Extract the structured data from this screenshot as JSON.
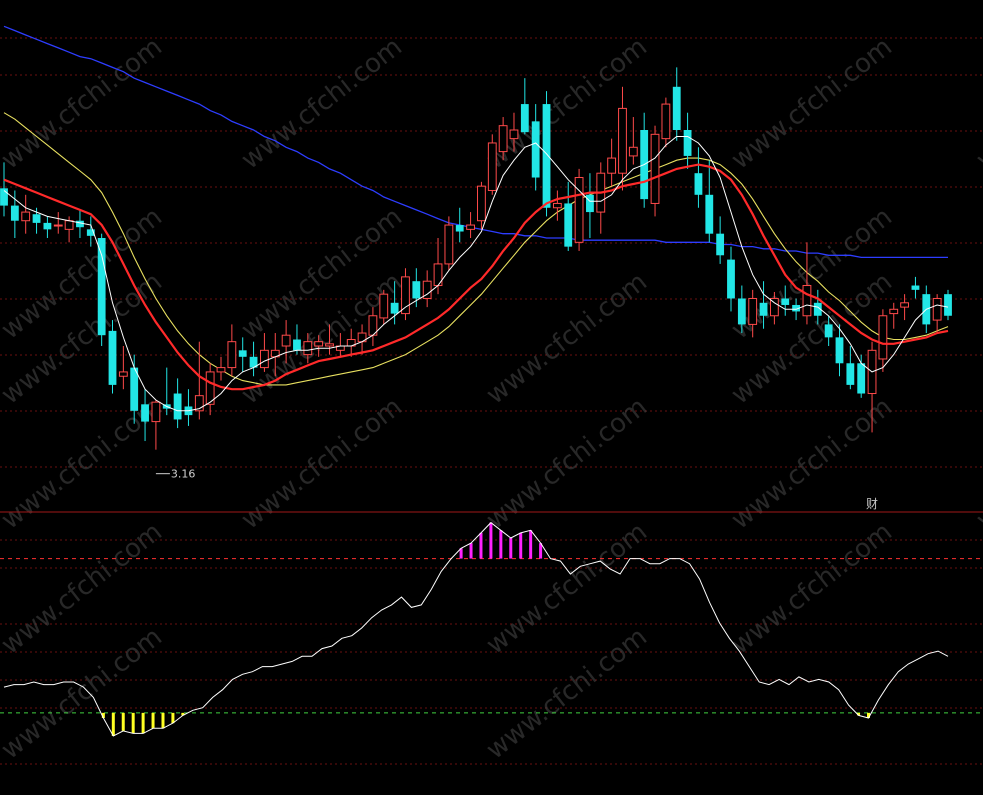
{
  "chart_data": [
    {
      "type": "candlestick",
      "panel": "price",
      "ylim": [
        2.85,
        5.1
      ],
      "grid": "horizontal dotted red",
      "annotations": {
        "low_label": "3.16",
        "marker_char": "财"
      },
      "colors": {
        "up": "#ff4a4a",
        "down": "#22e6e6",
        "ma_short": "#ffffff",
        "ma_mid": "#ff2a2a",
        "ma_long_yellow": "#e8e060",
        "ma_long_blue": "#2d3dff"
      },
      "candles": [
        {
          "o": 4.33,
          "h": 4.45,
          "l": 4.2,
          "c": 4.25
        },
        {
          "o": 4.25,
          "h": 4.32,
          "l": 4.1,
          "c": 4.18
        },
        {
          "o": 4.18,
          "h": 4.3,
          "l": 4.12,
          "c": 4.22
        },
        {
          "o": 4.21,
          "h": 4.24,
          "l": 4.12,
          "c": 4.17
        },
        {
          "o": 4.17,
          "h": 4.2,
          "l": 4.1,
          "c": 4.14
        },
        {
          "o": 4.16,
          "h": 4.22,
          "l": 4.12,
          "c": 4.16
        },
        {
          "o": 4.14,
          "h": 4.2,
          "l": 4.08,
          "c": 4.18
        },
        {
          "o": 4.18,
          "h": 4.23,
          "l": 4.1,
          "c": 4.15
        },
        {
          "o": 4.14,
          "h": 4.2,
          "l": 4.06,
          "c": 4.11
        },
        {
          "o": 4.1,
          "h": 4.12,
          "l": 3.6,
          "c": 3.65
        },
        {
          "o": 3.67,
          "h": 3.72,
          "l": 3.38,
          "c": 3.42
        },
        {
          "o": 3.46,
          "h": 3.6,
          "l": 3.4,
          "c": 3.48
        },
        {
          "o": 3.5,
          "h": 3.56,
          "l": 3.24,
          "c": 3.3
        },
        {
          "o": 3.33,
          "h": 3.4,
          "l": 3.16,
          "c": 3.25
        },
        {
          "o": 3.25,
          "h": 3.35,
          "l": 3.12,
          "c": 3.34
        },
        {
          "o": 3.33,
          "h": 3.5,
          "l": 3.28,
          "c": 3.31
        },
        {
          "o": 3.38,
          "h": 3.45,
          "l": 3.22,
          "c": 3.26
        },
        {
          "o": 3.32,
          "h": 3.4,
          "l": 3.23,
          "c": 3.28
        },
        {
          "o": 3.3,
          "h": 3.62,
          "l": 3.26,
          "c": 3.37
        },
        {
          "o": 3.33,
          "h": 3.52,
          "l": 3.28,
          "c": 3.48
        },
        {
          "o": 3.48,
          "h": 3.55,
          "l": 3.44,
          "c": 3.5
        },
        {
          "o": 3.5,
          "h": 3.7,
          "l": 3.46,
          "c": 3.62
        },
        {
          "o": 3.58,
          "h": 3.64,
          "l": 3.48,
          "c": 3.55
        },
        {
          "o": 3.55,
          "h": 3.62,
          "l": 3.46,
          "c": 3.5
        },
        {
          "o": 3.5,
          "h": 3.66,
          "l": 3.48,
          "c": 3.58
        },
        {
          "o": 3.55,
          "h": 3.66,
          "l": 3.46,
          "c": 3.58
        },
        {
          "o": 3.6,
          "h": 3.72,
          "l": 3.52,
          "c": 3.65
        },
        {
          "o": 3.63,
          "h": 3.7,
          "l": 3.56,
          "c": 3.58
        },
        {
          "o": 3.56,
          "h": 3.66,
          "l": 3.52,
          "c": 3.62
        },
        {
          "o": 3.6,
          "h": 3.65,
          "l": 3.55,
          "c": 3.62
        },
        {
          "o": 3.6,
          "h": 3.7,
          "l": 3.56,
          "c": 3.61
        },
        {
          "o": 3.58,
          "h": 3.66,
          "l": 3.55,
          "c": 3.6
        },
        {
          "o": 3.6,
          "h": 3.68,
          "l": 3.55,
          "c": 3.63
        },
        {
          "o": 3.62,
          "h": 3.7,
          "l": 3.56,
          "c": 3.66
        },
        {
          "o": 3.65,
          "h": 3.78,
          "l": 3.6,
          "c": 3.74
        },
        {
          "o": 3.73,
          "h": 3.86,
          "l": 3.7,
          "c": 3.84
        },
        {
          "o": 3.8,
          "h": 3.9,
          "l": 3.7,
          "c": 3.75
        },
        {
          "o": 3.75,
          "h": 3.96,
          "l": 3.72,
          "c": 3.92
        },
        {
          "o": 3.9,
          "h": 3.96,
          "l": 3.78,
          "c": 3.82
        },
        {
          "o": 3.82,
          "h": 3.95,
          "l": 3.78,
          "c": 3.9
        },
        {
          "o": 3.88,
          "h": 4.1,
          "l": 3.84,
          "c": 3.98
        },
        {
          "o": 3.98,
          "h": 4.2,
          "l": 3.95,
          "c": 4.16
        },
        {
          "o": 4.16,
          "h": 4.24,
          "l": 4.08,
          "c": 4.13
        },
        {
          "o": 4.14,
          "h": 4.22,
          "l": 4.1,
          "c": 4.16
        },
        {
          "o": 4.18,
          "h": 4.36,
          "l": 4.14,
          "c": 4.34
        },
        {
          "o": 4.32,
          "h": 4.58,
          "l": 4.3,
          "c": 4.54
        },
        {
          "o": 4.5,
          "h": 4.66,
          "l": 4.46,
          "c": 4.62
        },
        {
          "o": 4.56,
          "h": 4.68,
          "l": 4.5,
          "c": 4.6
        },
        {
          "o": 4.72,
          "h": 4.84,
          "l": 4.58,
          "c": 4.59
        },
        {
          "o": 4.64,
          "h": 4.72,
          "l": 4.32,
          "c": 4.38
        },
        {
          "o": 4.72,
          "h": 4.78,
          "l": 4.2,
          "c": 4.24
        },
        {
          "o": 4.24,
          "h": 4.32,
          "l": 4.18,
          "c": 4.26
        },
        {
          "o": 4.26,
          "h": 4.36,
          "l": 4.04,
          "c": 4.06
        },
        {
          "o": 4.08,
          "h": 4.42,
          "l": 4.04,
          "c": 4.38
        },
        {
          "o": 4.3,
          "h": 4.4,
          "l": 4.1,
          "c": 4.22
        },
        {
          "o": 4.22,
          "h": 4.45,
          "l": 4.12,
          "c": 4.4
        },
        {
          "o": 4.4,
          "h": 4.56,
          "l": 4.34,
          "c": 4.47
        },
        {
          "o": 4.4,
          "h": 4.8,
          "l": 4.32,
          "c": 4.7
        },
        {
          "o": 4.48,
          "h": 4.66,
          "l": 4.44,
          "c": 4.52
        },
        {
          "o": 4.6,
          "h": 4.68,
          "l": 4.24,
          "c": 4.28
        },
        {
          "o": 4.26,
          "h": 4.62,
          "l": 4.2,
          "c": 4.58
        },
        {
          "o": 4.56,
          "h": 4.75,
          "l": 4.52,
          "c": 4.72
        },
        {
          "o": 4.8,
          "h": 4.89,
          "l": 4.55,
          "c": 4.6
        },
        {
          "o": 4.6,
          "h": 4.68,
          "l": 4.42,
          "c": 4.48
        },
        {
          "o": 4.4,
          "h": 4.52,
          "l": 4.24,
          "c": 4.3
        },
        {
          "o": 4.3,
          "h": 4.46,
          "l": 4.08,
          "c": 4.12
        },
        {
          "o": 4.12,
          "h": 4.2,
          "l": 3.98,
          "c": 4.02
        },
        {
          "o": 4.0,
          "h": 4.06,
          "l": 3.76,
          "c": 3.82
        },
        {
          "o": 3.82,
          "h": 3.88,
          "l": 3.66,
          "c": 3.7
        },
        {
          "o": 3.7,
          "h": 3.86,
          "l": 3.64,
          "c": 3.82
        },
        {
          "o": 3.8,
          "h": 3.9,
          "l": 3.68,
          "c": 3.74
        },
        {
          "o": 3.74,
          "h": 3.85,
          "l": 3.7,
          "c": 3.82
        },
        {
          "o": 3.82,
          "h": 3.88,
          "l": 3.74,
          "c": 3.79
        },
        {
          "o": 3.79,
          "h": 3.82,
          "l": 3.72,
          "c": 3.76
        },
        {
          "o": 3.74,
          "h": 4.08,
          "l": 3.7,
          "c": 3.88
        },
        {
          "o": 3.8,
          "h": 3.86,
          "l": 3.7,
          "c": 3.74
        },
        {
          "o": 3.7,
          "h": 3.74,
          "l": 3.6,
          "c": 3.64
        },
        {
          "o": 3.64,
          "h": 3.7,
          "l": 3.46,
          "c": 3.52
        },
        {
          "o": 3.52,
          "h": 3.6,
          "l": 3.4,
          "c": 3.42
        },
        {
          "o": 3.52,
          "h": 3.56,
          "l": 3.36,
          "c": 3.38
        },
        {
          "o": 3.38,
          "h": 3.62,
          "l": 3.2,
          "c": 3.58
        },
        {
          "o": 3.54,
          "h": 3.77,
          "l": 3.48,
          "c": 3.74
        },
        {
          "o": 3.75,
          "h": 3.8,
          "l": 3.68,
          "c": 3.77
        },
        {
          "o": 3.78,
          "h": 3.84,
          "l": 3.72,
          "c": 3.8
        },
        {
          "o": 3.88,
          "h": 3.92,
          "l": 3.82,
          "c": 3.86
        },
        {
          "o": 3.84,
          "h": 3.88,
          "l": 3.66,
          "c": 3.7
        },
        {
          "o": 3.72,
          "h": 3.84,
          "l": 3.66,
          "c": 3.82
        },
        {
          "o": 3.84,
          "h": 3.86,
          "l": 3.72,
          "c": 3.74
        }
      ],
      "ma_short": [
        4.32,
        4.28,
        4.24,
        4.22,
        4.2,
        4.19,
        4.18,
        4.17,
        4.16,
        4.02,
        3.8,
        3.64,
        3.5,
        3.4,
        3.35,
        3.32,
        3.3,
        3.3,
        3.31,
        3.34,
        3.38,
        3.44,
        3.48,
        3.5,
        3.53,
        3.55,
        3.57,
        3.58,
        3.58,
        3.59,
        3.59,
        3.6,
        3.6,
        3.62,
        3.65,
        3.7,
        3.74,
        3.78,
        3.81,
        3.84,
        3.88,
        3.95,
        4.01,
        4.06,
        4.13,
        4.27,
        4.39,
        4.46,
        4.52,
        4.54,
        4.49,
        4.43,
        4.37,
        4.32,
        4.27,
        4.27,
        4.3,
        4.37,
        4.42,
        4.44,
        4.47,
        4.53,
        4.57,
        4.57,
        4.54,
        4.48,
        4.38,
        4.22,
        4.06,
        3.93,
        3.84,
        3.8,
        3.77,
        3.77,
        3.79,
        3.78,
        3.74,
        3.68,
        3.61,
        3.52,
        3.48,
        3.5,
        3.56,
        3.64,
        3.72,
        3.77,
        3.79,
        3.78
      ],
      "ma_mid": [
        4.37,
        4.35,
        4.33,
        4.31,
        4.29,
        4.27,
        4.25,
        4.23,
        4.21,
        4.16,
        4.08,
        3.98,
        3.88,
        3.79,
        3.71,
        3.64,
        3.57,
        3.51,
        3.46,
        3.43,
        3.41,
        3.4,
        3.4,
        3.41,
        3.42,
        3.44,
        3.47,
        3.49,
        3.51,
        3.53,
        3.54,
        3.55,
        3.56,
        3.57,
        3.58,
        3.6,
        3.62,
        3.64,
        3.67,
        3.7,
        3.73,
        3.77,
        3.82,
        3.87,
        3.91,
        3.97,
        4.04,
        4.1,
        4.17,
        4.22,
        4.26,
        4.28,
        4.29,
        4.3,
        4.31,
        4.31,
        4.32,
        4.34,
        4.35,
        4.36,
        4.38,
        4.4,
        4.42,
        4.43,
        4.44,
        4.43,
        4.41,
        4.37,
        4.3,
        4.21,
        4.11,
        4.02,
        3.93,
        3.87,
        3.84,
        3.82,
        3.78,
        3.74,
        3.7,
        3.66,
        3.63,
        3.61,
        3.61,
        3.62,
        3.63,
        3.64,
        3.66,
        3.67
      ],
      "ma_yellow": [
        4.68,
        4.65,
        4.61,
        4.57,
        4.53,
        4.49,
        4.45,
        4.41,
        4.37,
        4.31,
        4.22,
        4.12,
        4.01,
        3.91,
        3.82,
        3.74,
        3.67,
        3.61,
        3.56,
        3.52,
        3.49,
        3.46,
        3.44,
        3.43,
        3.42,
        3.42,
        3.42,
        3.43,
        3.44,
        3.45,
        3.46,
        3.47,
        3.48,
        3.49,
        3.5,
        3.52,
        3.54,
        3.56,
        3.59,
        3.62,
        3.65,
        3.69,
        3.74,
        3.79,
        3.84,
        3.9,
        3.96,
        4.02,
        4.08,
        4.13,
        4.18,
        4.22,
        4.25,
        4.28,
        4.3,
        4.32,
        4.34,
        4.36,
        4.38,
        4.4,
        4.42,
        4.44,
        4.46,
        4.47,
        4.47,
        4.46,
        4.44,
        4.4,
        4.35,
        4.28,
        4.2,
        4.12,
        4.05,
        3.99,
        3.94,
        3.9,
        3.85,
        3.81,
        3.76,
        3.71,
        3.67,
        3.64,
        3.63,
        3.63,
        3.64,
        3.65,
        3.67,
        3.69
      ],
      "ma_blue": [
        5.08,
        5.06,
        5.04,
        5.02,
        5.0,
        4.98,
        4.96,
        4.94,
        4.93,
        4.91,
        4.89,
        4.87,
        4.84,
        4.82,
        4.8,
        4.78,
        4.76,
        4.74,
        4.72,
        4.69,
        4.67,
        4.64,
        4.62,
        4.6,
        4.57,
        4.55,
        4.52,
        4.5,
        4.47,
        4.45,
        4.42,
        4.4,
        4.37,
        4.34,
        4.32,
        4.29,
        4.27,
        4.25,
        4.23,
        4.21,
        4.19,
        4.17,
        4.16,
        4.15,
        4.14,
        4.13,
        4.12,
        4.12,
        4.11,
        4.11,
        4.1,
        4.1,
        4.1,
        4.09,
        4.09,
        4.09,
        4.09,
        4.09,
        4.09,
        4.09,
        4.09,
        4.08,
        4.08,
        4.08,
        4.08,
        4.08,
        4.07,
        4.07,
        4.06,
        4.06,
        4.05,
        4.05,
        4.04,
        4.04,
        4.03,
        4.03,
        4.02,
        4.02,
        4.02,
        4.01,
        4.01,
        4.01,
        4.01,
        4.01,
        4.01,
        4.01,
        4.01,
        4.01
      ]
    },
    {
      "type": "line+histogram",
      "panel": "indicator",
      "ylim": [
        -10,
        95
      ],
      "upper_level": 80,
      "lower_level": 20,
      "colors": {
        "line": "#ffffff",
        "upper_bar": "#ff22ff",
        "lower_bar": "#ffff22",
        "upper_ref": "#ff3030",
        "lower_ref": "#40d040"
      },
      "values": [
        30,
        31,
        31,
        32,
        31,
        31,
        32,
        32,
        30,
        26,
        18,
        11,
        13,
        12,
        12,
        14,
        14,
        16,
        19,
        21,
        22,
        26,
        29,
        33,
        35,
        36,
        38,
        38,
        39,
        40,
        42,
        42,
        45,
        46,
        49,
        50,
        53,
        57,
        60,
        62,
        65,
        61,
        62,
        68,
        75,
        80,
        84,
        86,
        90,
        94,
        91,
        88,
        90,
        91,
        86,
        80,
        79,
        74,
        77,
        78,
        79,
        76,
        74,
        80,
        80,
        78,
        78,
        80,
        80,
        78,
        72,
        63,
        55,
        49,
        44,
        38,
        32,
        31,
        33,
        31,
        34,
        32,
        33,
        32,
        29,
        23,
        19,
        18,
        25,
        31,
        36,
        39,
        41,
        43,
        44,
        42
      ]
    }
  ]
}
